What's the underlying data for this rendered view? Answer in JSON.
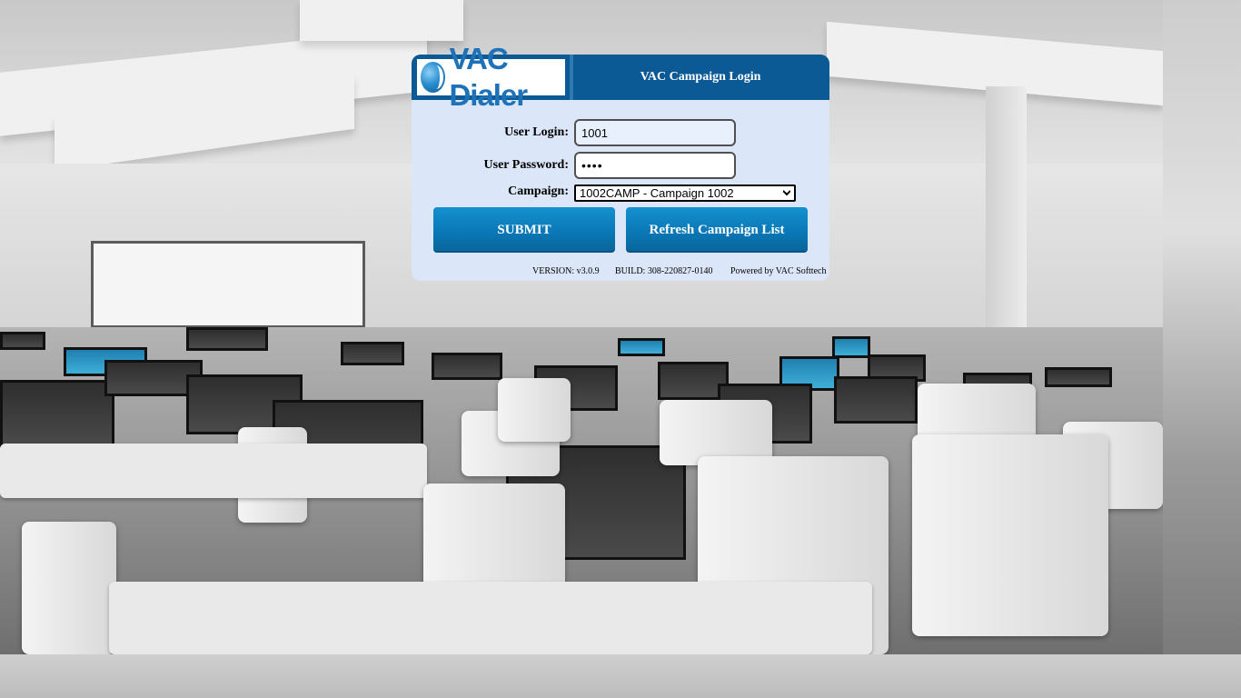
{
  "header": {
    "logo_text": "VAC Dialer",
    "title": "VAC Campaign Login"
  },
  "form": {
    "user_login_label": "User Login:",
    "user_login_value": "1001",
    "user_password_label": "User Password:",
    "user_password_value": "••••",
    "campaign_label": "Campaign:",
    "campaign_selected": "1002CAMP - Campaign 1002"
  },
  "buttons": {
    "submit": "SUBMIT",
    "refresh": "Refresh Campaign List"
  },
  "footer": {
    "version": "VERSION: v3.0.9",
    "build": "BUILD: 308-220827-0140",
    "powered_by": "Powered by VAC Softtech"
  },
  "colors": {
    "header_bg": "#0b5a96",
    "panel_bg": "#dbe6f8",
    "button_bg": "#0b78b6"
  }
}
